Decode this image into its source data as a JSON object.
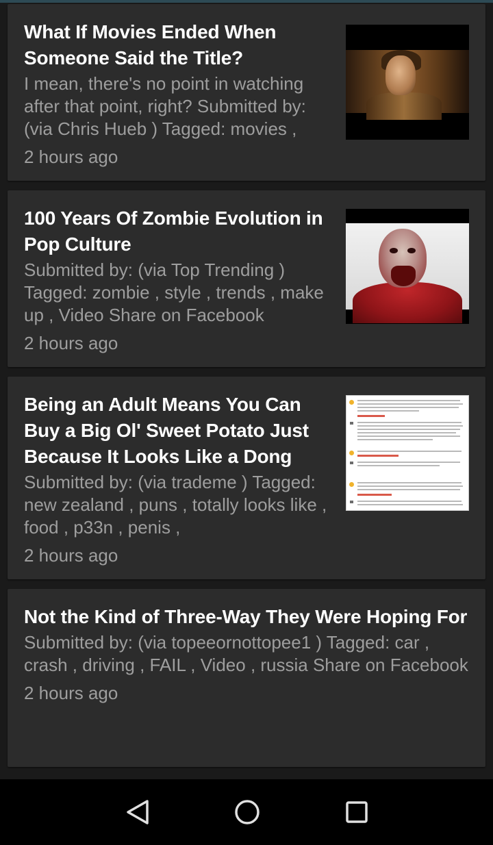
{
  "feed": {
    "items": [
      {
        "title": "What If Movies Ended When Someone Said the Title?",
        "description": "I mean, there's no point in watching after that point, right? Submitted by: (via Chris Hueb ) Tagged: movies ,",
        "time": "2 hours ago",
        "thumbnail": "actor-still"
      },
      {
        "title": "100 Years Of Zombie Evolution in Pop Culture",
        "description": "Submitted by: (via Top Trending ) Tagged: zombie , style , trends , make up , Video Share on Facebook",
        "time": "2 hours ago",
        "thumbnail": "zombie-still"
      },
      {
        "title": "Being an Adult Means You Can Buy a Big Ol' Sweet Potato Just Because It Looks Like a Dong",
        "description": "Submitted by: (via trademe ) Tagged: new zealand , puns , totally looks like , food , p33n , penis ,",
        "time": "2 hours ago",
        "thumbnail": "comments-screenshot"
      },
      {
        "title": "Not the Kind of Three-Way They Were Hoping For",
        "description": "Submitted by: (via topeeornottopee1 ) Tagged: car , crash , driving , FAIL , Video , russia Share on Facebook",
        "time": "2 hours ago"
      }
    ]
  },
  "navigation": {
    "back_icon": "triangle-back-icon",
    "home_icon": "circle-home-icon",
    "recents_icon": "square-recents-icon"
  },
  "colors": {
    "background": "#1a1a1a",
    "card": "#2c2c2c",
    "title": "#ffffff",
    "secondary_text": "#9e9e9e",
    "navbar": "#000000"
  }
}
